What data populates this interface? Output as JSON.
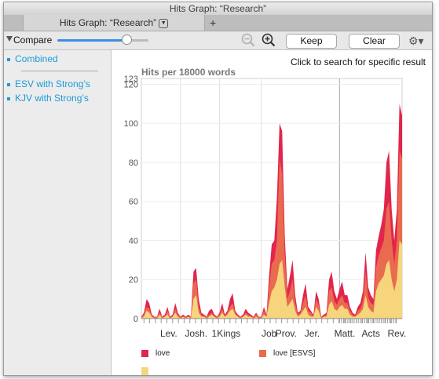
{
  "window": {
    "title": "Hits Graph: “Research”"
  },
  "tabs": [
    {
      "label": "Hits Graph: “Research”",
      "menu_icon": "chevron-down-icon"
    }
  ],
  "new_tab_icon": "plus-icon",
  "toolbar": {
    "compare_label": "Compare",
    "compare_slider_fraction": 0.76,
    "zoom_out_icon": "zoom-out-icon",
    "zoom_in_icon": "zoom-in-icon",
    "keep_label": "Keep",
    "clear_label": "Clear",
    "settings_icon": "gear-icon",
    "accent_color": "#3b8ee4"
  },
  "sidebar": {
    "items": [
      {
        "label": "Combined"
      },
      {
        "label": "ESV with Strong’s"
      },
      {
        "label": "KJV with Strong’s"
      }
    ],
    "link_color": "#1a9bd7"
  },
  "main": {
    "hint": "Click to search for specific result"
  },
  "chart_data": {
    "type": "area",
    "title": "Hits per 18000 words",
    "ylim": [
      0,
      123
    ],
    "yticks": [
      0,
      20,
      40,
      60,
      80,
      100,
      120
    ],
    "ymax_label": "123",
    "grid": true,
    "xlim": [
      0,
      100
    ],
    "x_labels": [
      {
        "label": "Lev.",
        "x": 10.5
      },
      {
        "label": "Josh.",
        "x": 21
      },
      {
        "label": "1Kings",
        "x": 32.5
      },
      {
        "label": "Job",
        "x": 49
      },
      {
        "label": "Prov.",
        "x": 55.5
      },
      {
        "label": "Jer.",
        "x": 65.5
      },
      {
        "label": "Matt.",
        "x": 78
      },
      {
        "label": "Acts",
        "x": 88
      },
      {
        "label": "Rev.",
        "x": 98
      }
    ],
    "x": [
      0,
      1,
      2,
      3,
      4,
      5,
      6,
      7,
      8,
      9,
      10,
      11,
      12,
      13,
      14,
      15,
      16,
      17,
      18,
      19,
      20,
      21,
      22,
      23,
      24,
      25,
      26,
      27,
      28,
      29,
      30,
      31,
      32,
      33,
      34,
      35,
      36,
      37,
      38,
      39,
      40,
      41,
      42,
      43,
      44,
      45,
      46,
      47,
      48,
      49,
      50,
      51,
      52,
      53,
      54,
      55,
      56,
      57,
      58,
      59,
      60,
      61,
      62,
      63,
      64,
      65,
      66,
      67,
      68,
      69,
      70,
      71,
      72,
      73,
      74,
      75,
      76,
      77,
      78,
      79,
      80,
      81,
      82,
      83,
      84,
      85,
      86,
      87,
      88,
      89,
      90,
      91,
      92,
      93,
      94,
      95,
      96,
      97,
      98,
      99,
      100
    ],
    "series": [
      {
        "name": "love",
        "color": "#e2254d",
        "values": [
          1,
          3,
          10,
          8,
          2,
          1,
          1,
          5,
          1,
          2,
          6,
          1,
          2,
          8,
          3,
          1,
          2,
          1,
          2,
          1,
          24,
          26,
          10,
          3,
          2,
          1,
          4,
          5,
          2,
          1,
          3,
          8,
          2,
          4,
          10,
          13,
          4,
          2,
          1,
          2,
          5,
          3,
          2,
          1,
          3,
          1,
          1,
          6,
          2,
          22,
          38,
          40,
          62,
          100,
          96,
          42,
          15,
          22,
          30,
          12,
          3,
          4,
          12,
          18,
          6,
          4,
          2,
          14,
          10,
          1,
          2,
          3,
          20,
          24,
          14,
          10,
          15,
          19,
          12,
          12,
          6,
          3,
          2,
          6,
          8,
          14,
          34,
          16,
          12,
          10,
          35,
          42,
          48,
          56,
          80,
          86,
          56,
          40,
          56,
          110,
          104
        ]
      },
      {
        "name": "love [ESVS]",
        "color": "#ea6a4f",
        "values": [
          1,
          2,
          6,
          5,
          1,
          1,
          1,
          3,
          1,
          1,
          4,
          1,
          1,
          5,
          2,
          1,
          1,
          1,
          1,
          1,
          18,
          20,
          6,
          2,
          1,
          1,
          2,
          3,
          1,
          1,
          2,
          5,
          1,
          3,
          6,
          8,
          3,
          1,
          1,
          1,
          3,
          2,
          1,
          1,
          2,
          1,
          1,
          4,
          1,
          16,
          28,
          30,
          40,
          82,
          74,
          32,
          10,
          14,
          20,
          8,
          2,
          3,
          8,
          12,
          4,
          3,
          1,
          10,
          7,
          1,
          1,
          2,
          14,
          16,
          9,
          7,
          10,
          12,
          8,
          8,
          4,
          2,
          1,
          4,
          5,
          9,
          24,
          11,
          8,
          7,
          26,
          32,
          36,
          40,
          56,
          60,
          40,
          28,
          40,
          86,
          82
        ]
      },
      {
        "name": "",
        "color": "#f6d57c",
        "values": [
          0,
          1,
          4,
          3,
          1,
          0,
          0,
          2,
          0,
          1,
          2,
          0,
          1,
          3,
          1,
          0,
          1,
          0,
          1,
          0,
          10,
          12,
          3,
          1,
          1,
          0,
          1,
          2,
          1,
          0,
          1,
          3,
          1,
          2,
          4,
          5,
          2,
          1,
          0,
          1,
          2,
          1,
          1,
          0,
          1,
          0,
          0,
          2,
          1,
          8,
          14,
          16,
          20,
          28,
          30,
          16,
          6,
          8,
          10,
          4,
          1,
          2,
          4,
          6,
          2,
          1,
          1,
          6,
          4,
          0,
          1,
          1,
          7,
          9,
          5,
          4,
          6,
          7,
          5,
          5,
          2,
          1,
          1,
          2,
          3,
          5,
          12,
          6,
          4,
          3,
          14,
          18,
          20,
          22,
          28,
          30,
          20,
          14,
          20,
          40,
          38
        ]
      }
    ],
    "legend": [
      "love",
      "love [ESVS]"
    ]
  }
}
